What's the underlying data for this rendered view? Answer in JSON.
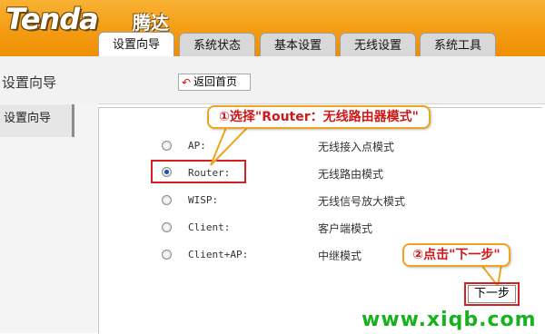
{
  "brand": {
    "logo": "Tenda",
    "logo_cn": "腾达"
  },
  "tabs": [
    {
      "label": "设置向导",
      "active": true
    },
    {
      "label": "系统状态",
      "active": false
    },
    {
      "label": "基本设置",
      "active": false
    },
    {
      "label": "无线设置",
      "active": false
    },
    {
      "label": "系统工具",
      "active": false
    }
  ],
  "page": {
    "title": "设置向导",
    "home_button": "返回首页"
  },
  "sidebar": {
    "items": [
      {
        "label": "设置向导",
        "active": true
      }
    ]
  },
  "modes": [
    {
      "label": "AP:",
      "desc": "无线接入点模式",
      "checked": false
    },
    {
      "label": "Router:",
      "desc": "无线路由模式",
      "checked": true
    },
    {
      "label": "WISP:",
      "desc": "无线信号放大模式",
      "checked": false
    },
    {
      "label": "Client:",
      "desc": "客户端模式",
      "checked": false
    },
    {
      "label": "Client+AP:",
      "desc": "中继模式",
      "checked": false
    }
  ],
  "annotations": {
    "step1": "①选择\"Router：无线路由器模式\"",
    "step2": "②点击\"下一步\""
  },
  "buttons": {
    "next": "下一步"
  },
  "watermark": "www.xiqb.com",
  "colors": {
    "header": "#f39a10",
    "callout_border": "#f0a41c",
    "callout_text": "#d01818",
    "highlight": "#d42020",
    "watermark": "#17b31d",
    "radio_checked": "#1a4fb5"
  }
}
